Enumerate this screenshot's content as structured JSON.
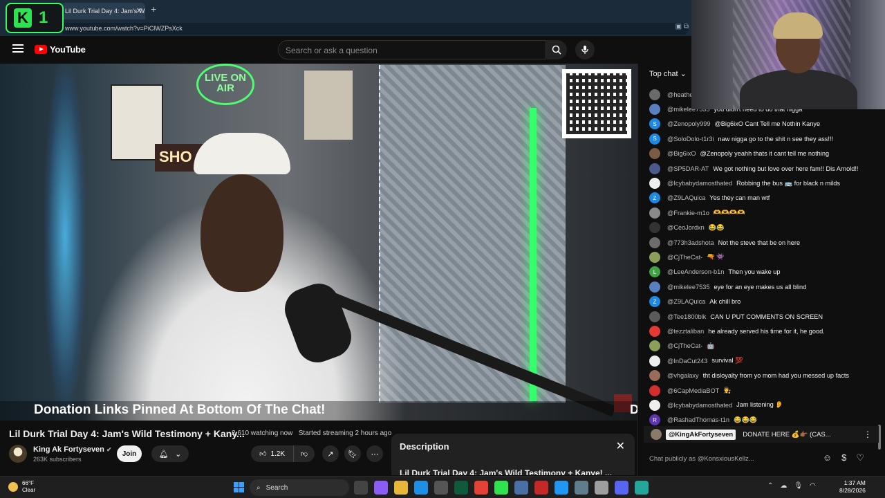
{
  "browser": {
    "tab_title": "Lil Durk Trial Day 4: Jam's Wild",
    "url": "www.youtube.com/watch?v=PiClWZPsXck"
  },
  "overlay_logo": {
    "letter": "K",
    "number": "1"
  },
  "youtube": {
    "logo_text": "YouTube",
    "search_placeholder": "Search or ask a question"
  },
  "video": {
    "scene_text": {
      "live_sign": "LIVE ON AIR",
      "shop_sign": "SHO",
      "corner_letter": "D"
    },
    "banner": "Donation Links Pinned At Bottom Of The Chat!",
    "title": "Lil Durk Trial Day 4: Jam's Wild Testimony + Kany...",
    "watching": "2,610 watching now",
    "started": "Started streaming 2 hours ago",
    "channel_name": "King Ak Fortyseven",
    "subscribers": "263K subscribers",
    "join_label": "Join",
    "like_count": "1.2K"
  },
  "description": {
    "title": "Description",
    "snippet": "Lil Durk Trial Day 4: Jam's Wild Testimony + Kanye! ..."
  },
  "chat": {
    "header": "Top chat",
    "messages": [
      {
        "author": "@heathe",
        "text": "",
        "color": "#6a6a6a",
        "initial": ""
      },
      {
        "author": "@mikelee7535",
        "text": "you didn't need to do that nigga",
        "color": "#5a7fbf",
        "initial": ""
      },
      {
        "author": "@Zenopoly999",
        "text": "@Big6ixO Cant Tell me Nothin Kanye",
        "color": "#1e88e5",
        "initial": "S"
      },
      {
        "author": "@SoloDolo-t1r3i",
        "text": "naw nigga go to the shit n see they ass!!!",
        "color": "#1e88e5",
        "initial": "S"
      },
      {
        "author": "@Big6ixO",
        "text": "@Zenopoly yeahh thats it cant tell me nothing",
        "color": "#7a5b44",
        "initial": ""
      },
      {
        "author": "@SP5DAR-AT",
        "text": "We got nothing but love over here fam!! Dis Arnold!!",
        "color": "#4a5a8a",
        "initial": ""
      },
      {
        "author": "@Icybabydamosthated",
        "text": "Robbing the bus 🚌 for black n milds",
        "color": "#eeeeee",
        "initial": ""
      },
      {
        "author": "@Z9LAQuica",
        "text": "Yes they can man wtf",
        "color": "#1e88e5",
        "initial": "Z"
      },
      {
        "author": "@Frankie-m1o",
        "text": "🫶🫶🫶🫶",
        "color": "#8a8a8a",
        "initial": ""
      },
      {
        "author": "@CeoJordxn",
        "text": "😂😂",
        "color": "#333333",
        "initial": ""
      },
      {
        "author": "@773h3adshota",
        "text": "Not the steve that be on here",
        "color": "#6d6d6d",
        "initial": ""
      },
      {
        "author": "@CjTheCat-",
        "text": "🔫 👾",
        "color": "#8aa05a",
        "initial": ""
      },
      {
        "author": "@LeeAnderson-b1n",
        "text": "Then you wake up",
        "color": "#43a047",
        "initial": "L"
      },
      {
        "author": "@mikelee7535",
        "text": "eye for an eye makes us all blind",
        "color": "#5a7fbf",
        "initial": ""
      },
      {
        "author": "@Z9LAQuica",
        "text": "Ak chill bro",
        "color": "#1e88e5",
        "initial": "Z"
      },
      {
        "author": "@Tee1800blk",
        "text": "CAN U PUT COMMENTS ON SCREEN",
        "color": "#5a5a5a",
        "initial": ""
      },
      {
        "author": "@tezztaliban",
        "text": "he already served his time for it, he good.",
        "color": "#e53935",
        "initial": ""
      },
      {
        "author": "@CjTheCat-",
        "text": "🤖",
        "color": "#8aa05a",
        "initial": ""
      },
      {
        "author": "@InDaCut243",
        "text": "survival 💯",
        "color": "#eeeeee",
        "initial": ""
      },
      {
        "author": "@vhgalaxy",
        "text": "tht disloyalty from yo mom had you messed up facts",
        "color": "#9a6a5a",
        "initial": ""
      },
      {
        "author": "@6CapMediaBOT",
        "text": "👨‍⚖️",
        "color": "#d32f2f",
        "initial": ""
      },
      {
        "author": "@Icybabydamosthated",
        "text": "Jam listening 👂",
        "color": "#eeeeee",
        "initial": ""
      },
      {
        "author": "@RashadThomas-t1n",
        "text": "😂😂😂",
        "color": "#5e35b1",
        "initial": "R"
      }
    ],
    "pinned": {
      "author": "@KingAkFortyseven",
      "text": "DONATE HERE 💰👉🏾 (CAS..."
    },
    "input_placeholder": "Chat publicly as @KonsxiousKellz..."
  },
  "taskbar": {
    "temperature": "66°F",
    "condition": "Clear",
    "search_label": "Search",
    "time": "1:37 AM",
    "date": "8/28/2026"
  }
}
